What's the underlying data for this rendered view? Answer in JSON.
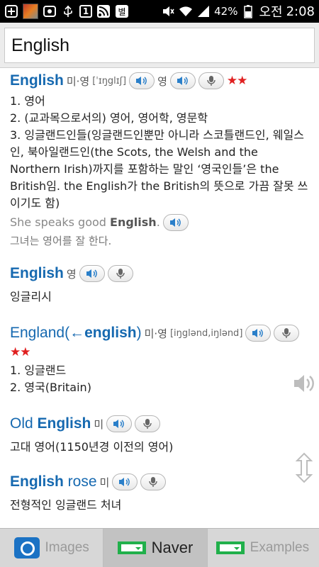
{
  "status_bar": {
    "sim_label": "1",
    "battery": "42%",
    "ampm": "오전",
    "time": "2:08"
  },
  "search": {
    "value": "English"
  },
  "entries": [
    {
      "headword": "English",
      "lang": "미·영",
      "pron": "[ˈɪŋglɪʃ]",
      "lang2": "영",
      "stars": "★★",
      "defs": [
        "1. 영어",
        "2. (교과목으로서의) 영어, 영어학, 영문학",
        "3. 잉글랜드인들(잉글랜드인뿐만 아니라 스코틀랜드인, 웨일스인, 북아일랜드인(the Scots, the Welsh and the Northern Irish)까지를 포함하는 말인 ‘영국인들’은 the British임. the English가 the British의 뜻으로 가끔 잘못 쓰이기도 함)"
      ],
      "example_en_pre": "She speaks good ",
      "example_en_bold": "English",
      "example_en_post": ".",
      "example_ko": "그녀는 영어를 잘 한다."
    },
    {
      "headword": "English",
      "lang": "영",
      "defs": [
        "잉글리시"
      ]
    },
    {
      "headword_pre": "England(←",
      "headword_bold": "english",
      "headword_post": ")",
      "lang": "미·영",
      "pron": "[iŋglənd,iŋlənd]",
      "stars": "★★",
      "defs": [
        "1. 잉글랜드",
        "2. 영국(Britain)"
      ]
    },
    {
      "headword_pre": "Old ",
      "headword_bold": "English",
      "lang": "미",
      "defs": [
        "고대 영어(1150년경 이전의 영어)"
      ]
    },
    {
      "headword_bold": "English",
      "headword_post": " rose",
      "lang": "미",
      "defs": [
        "전형적인 잉글랜드 처녀"
      ]
    }
  ],
  "bottom_tabs": {
    "images": "Images",
    "naver": "Naver",
    "examples": "Examples"
  },
  "colors": {
    "headword": "#1669b0",
    "stars": "#e02020",
    "naver_green": "#21b04b",
    "camera_blue": "#1b72c4"
  }
}
